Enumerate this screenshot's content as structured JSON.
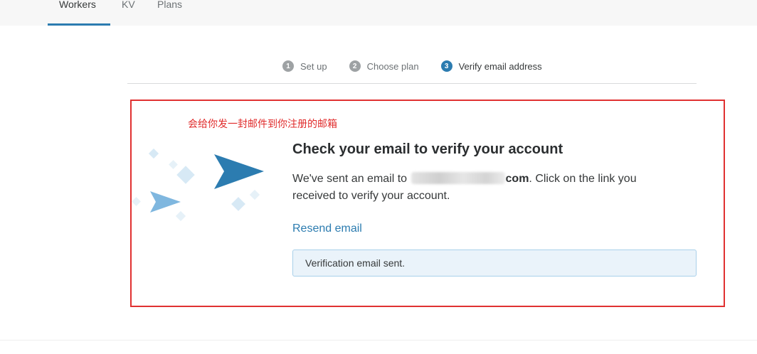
{
  "nav": {
    "tabs": [
      {
        "label": "Workers",
        "active": true
      },
      {
        "label": "KV",
        "active": false
      },
      {
        "label": "Plans",
        "active": false
      }
    ]
  },
  "stepper": {
    "steps": [
      {
        "number": "1",
        "label": "Set up",
        "current": false
      },
      {
        "number": "2",
        "label": "Choose plan",
        "current": false
      },
      {
        "number": "3",
        "label": "Verify email address",
        "current": true
      }
    ]
  },
  "annotation": {
    "text": "会给你发一封邮件到你注册的邮箱",
    "color": "#e03131"
  },
  "main": {
    "title": "Check your email to verify your account",
    "message_prefix": "We've sent an email to",
    "email_suffix": "com",
    "message_suffix": ". Click on the link you received to verify your account.",
    "resend_label": "Resend email",
    "notice": "Verification email sent."
  },
  "colors": {
    "accent": "#2c7cb0",
    "notice_bg": "#eaf3fa",
    "notice_border": "#a9d0ea"
  }
}
